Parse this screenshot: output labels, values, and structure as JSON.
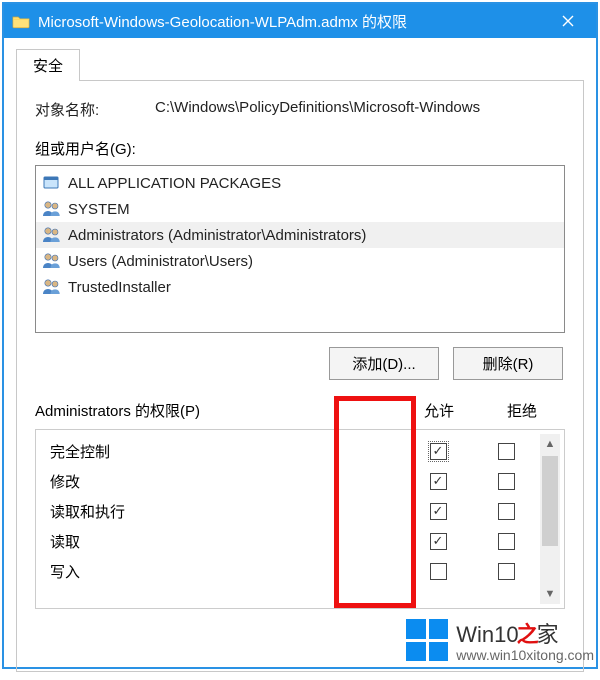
{
  "window": {
    "title": "Microsoft-Windows-Geolocation-WLPAdm.admx 的权限"
  },
  "tab": {
    "label": "安全"
  },
  "object": {
    "label": "对象名称:",
    "path": "C:\\Windows\\PolicyDefinitions\\Microsoft-Windows"
  },
  "groups": {
    "label": "组或用户名(G):",
    "items": [
      {
        "name": "ALL APPLICATION PACKAGES"
      },
      {
        "name": "SYSTEM"
      },
      {
        "name": "Administrators (Administrator\\Administrators)",
        "selected": true
      },
      {
        "name": "Users (Administrator\\Users)"
      },
      {
        "name": "TrustedInstaller"
      }
    ]
  },
  "buttons": {
    "add": "添加(D)...",
    "remove": "删除(R)"
  },
  "perm": {
    "title": "Administrators 的权限(P)",
    "col_allow": "允许",
    "col_deny": "拒绝",
    "rows": [
      {
        "name": "完全控制",
        "allow": true,
        "deny": false,
        "focus": true
      },
      {
        "name": "修改",
        "allow": true,
        "deny": false
      },
      {
        "name": "读取和执行",
        "allow": true,
        "deny": false
      },
      {
        "name": "读取",
        "allow": true,
        "deny": false
      },
      {
        "name": "写入",
        "allow": false,
        "deny": false
      }
    ]
  },
  "watermark": {
    "brand_pre": "Win10",
    "brand_hi": "之",
    "brand_post": "家",
    "url": "www.win10xitong.com"
  }
}
